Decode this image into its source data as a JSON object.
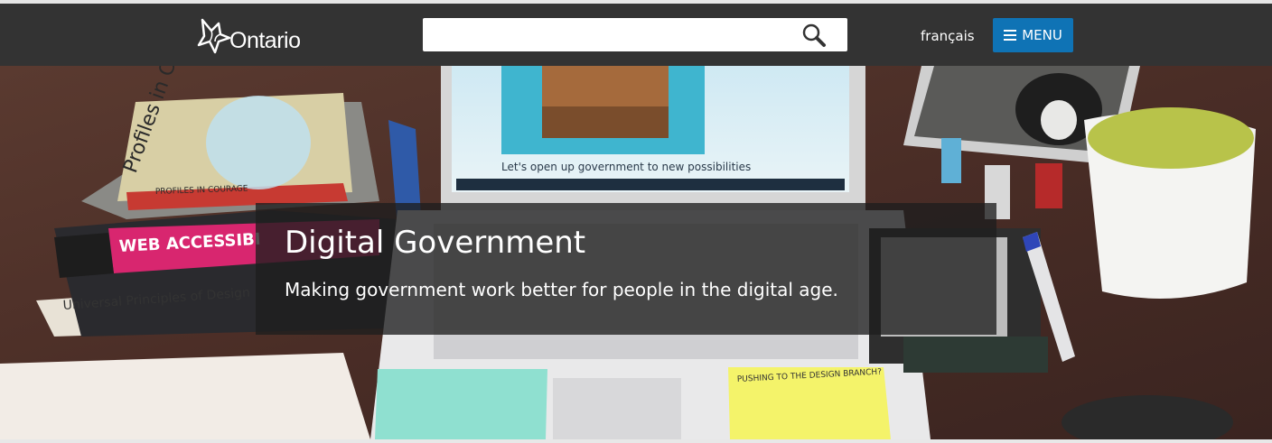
{
  "header": {
    "logo_text": "Ontario",
    "search": {
      "placeholder": "",
      "value": ""
    },
    "language_link": "français",
    "menu_label": "MENU"
  },
  "hero": {
    "title": "Digital Government",
    "subtitle": "Making government work better for people in the digital age.",
    "laptop_screen_caption": "Let's open up government to new possibilities",
    "book_titles": [
      "WEB ACCESSIBI",
      "Universal Principles of Design",
      "Profiles in Courage",
      "PROFILES IN COURAGE"
    ],
    "sticky_note_text": "PUSHING TO THE DESIGN BRANCH?"
  },
  "colors": {
    "header_bg": "#333333",
    "menu_button": "#0f73b5",
    "overlay": "rgba(30,30,30,0.78)"
  }
}
